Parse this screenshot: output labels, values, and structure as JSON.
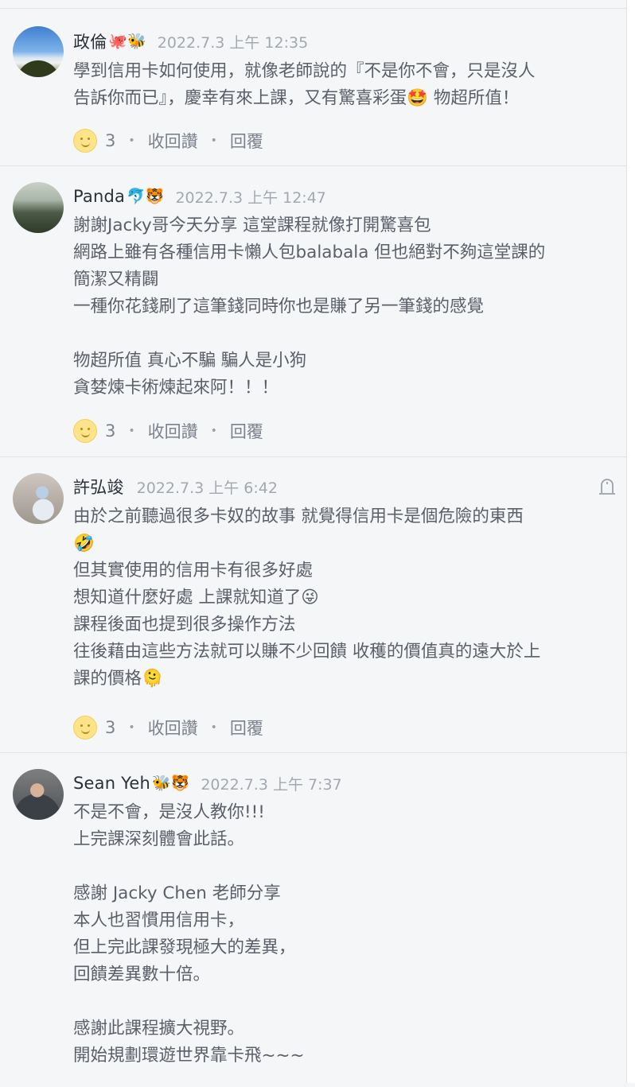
{
  "comments": [
    {
      "author": "政倫",
      "author_emoji": "🐙🐝",
      "date": "2022.7.3 上午 12:35",
      "text": "學到信用卡如何使用，就像老師說的『不是你不會，只是沒人\n告訴你而已』，慶幸有來上課，又有驚喜彩蛋🤩 物超所值！",
      "likes": "3",
      "retract_label": "收回讚",
      "reply_label": "回覆"
    },
    {
      "author": "Panda",
      "author_emoji": "🐬🐯",
      "date": "2022.7.3 上午 12:47",
      "text": "謝謝Jacky哥今天分享 這堂課程就像打開驚喜包\n網路上雖有各種信用卡懶人包balabala 但也絕對不夠這堂課的\n簡潔又精闢\n一種你花錢刷了這筆錢同時你也是賺了另一筆錢的感覺\n\n物超所值 真心不騙 騙人是小狗\n貪婪煉卡術煉起來阿！！！",
      "likes": "3",
      "retract_label": "收回讚",
      "reply_label": "回覆"
    },
    {
      "author": "許弘竣",
      "author_emoji": "",
      "date": "2022.7.3 上午 6:42",
      "text": "由於之前聽過很多卡奴的故事 就覺得信用卡是個危險的東西\n🤣\n但其實使用的信用卡有很多好處\n想知道什麼好處 上課就知道了😜\n課程後面也提到很多操作方法\n往後藉由這些方法就可以賺不少回饋 收穫的價值真的遠大於上\n課的價格🫠",
      "likes": "3",
      "retract_label": "收回讚",
      "reply_label": "回覆"
    },
    {
      "author": "Sean Yeh",
      "author_emoji": "🐝🐯",
      "date": "2022.7.3 上午 7:37",
      "text": "不是不會，是沒人教你!!!\n上完課深刻體會此話。\n\n感謝 Jacky Chen 老師分享\n本人也習慣用信用卡，\n但上完此課發現極大的差異，\n回饋差異數十倍。\n\n感謝此課程擴大視野。\n開始規劃環遊世界靠卡飛~~~"
    }
  ]
}
